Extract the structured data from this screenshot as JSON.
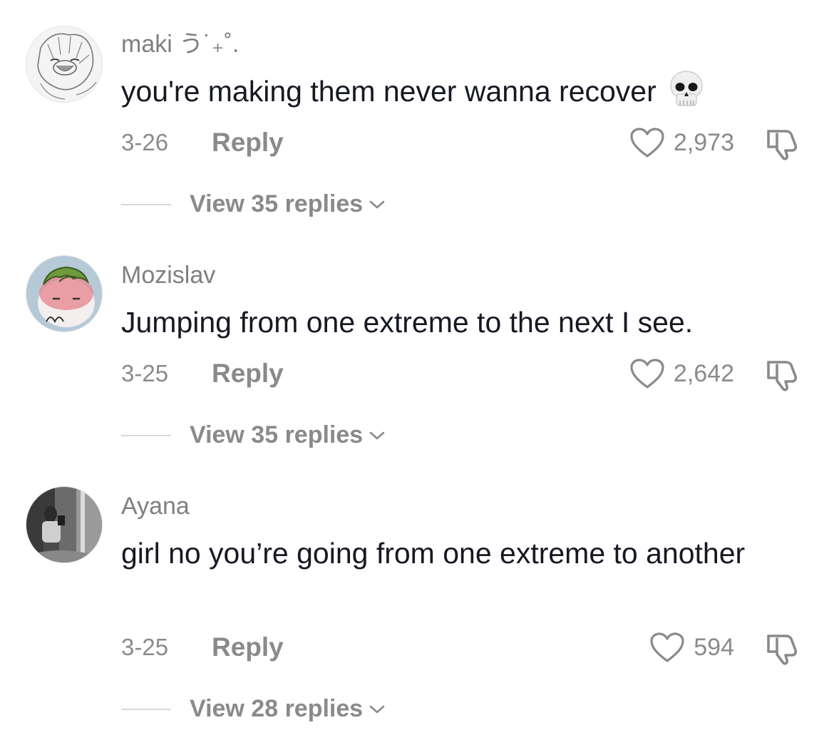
{
  "comments": [
    {
      "username": "maki う˙₊˚.",
      "text": "you're making them never wanna recover",
      "emoji": "skull",
      "date": "3-26",
      "reply_label": "Reply",
      "likes": "2,973",
      "view_replies": "View 35 replies"
    },
    {
      "username": "Mozislav",
      "text": "Jumping from one extreme to the next I see.",
      "date": "3-25",
      "reply_label": "Reply",
      "likes": "2,642",
      "view_replies": "View 35 replies"
    },
    {
      "username": "Ayana",
      "text": "girl no you’re going from one extreme to another",
      "date": "3-25",
      "reply_label": "Reply",
      "likes": "594",
      "view_replies": "View 28 replies"
    }
  ],
  "icons": {
    "like": "heart-icon",
    "dislike": "thumbs-down-icon",
    "expand": "chevron-down-icon",
    "emoji": "skull-icon"
  },
  "colors": {
    "text_primary": "#161823",
    "text_secondary": "#8a8a8a",
    "username": "#7f7f7f",
    "background": "#ffffff"
  }
}
